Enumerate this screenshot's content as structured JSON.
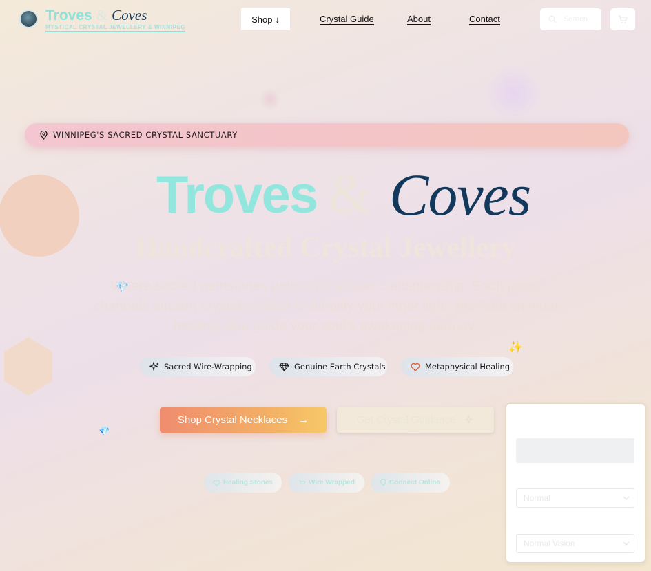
{
  "brand": {
    "name_part1": "Troves",
    "ampersand": "&",
    "name_part2": "Coves",
    "tagline": "MYSTICAL CRYSTAL JEWELLERY & WINNIPEG"
  },
  "nav": {
    "shop_label": "Shop",
    "shop_arrow": "↓",
    "crystal_guide": "Crystal Guide",
    "about": "About",
    "contact": "Contact",
    "search_placeholder": "Search"
  },
  "banner": {
    "text": "WINNIPEG'S SACRED CRYSTAL SANCTUARY"
  },
  "hero": {
    "title_part1": "Troves",
    "title_amp": "&",
    "title_part2": "Coves",
    "subtitle": "Handcrafted Crystal Jewellery",
    "description": "Where sacred gemstones unite with artisan craftsmanship. Each piece channels ancient crystal wisdom to amplify your inner light, promote spiritual healing, and guide your soul's awakening journey."
  },
  "features": [
    {
      "label": "Sacred Wire-Wrapping",
      "icon": "sparkles-icon"
    },
    {
      "label": "Genuine Earth Crystals",
      "icon": "gem-icon"
    },
    {
      "label": "Metaphysical Healing",
      "icon": "heart-icon"
    }
  ],
  "cta": {
    "primary": "Shop Crystal Necklaces",
    "primary_arrow": "→",
    "secondary": "Get Crystal Guidance"
  },
  "tags": [
    {
      "label": "Healing Stones",
      "icon": "heart-icon"
    },
    {
      "label": "Wire Wrapped",
      "icon": "cart-icon"
    },
    {
      "label": "Connect Online",
      "icon": "pin-icon"
    }
  ],
  "accessibility": {
    "text_size_value": "Normal",
    "vision_value": "Normal Vision"
  },
  "colors": {
    "teal": "#93e6dd",
    "navy": "#12395c",
    "coral": "#f08c6e",
    "gold": "#f7c867",
    "pink": "#f3c6d1"
  }
}
